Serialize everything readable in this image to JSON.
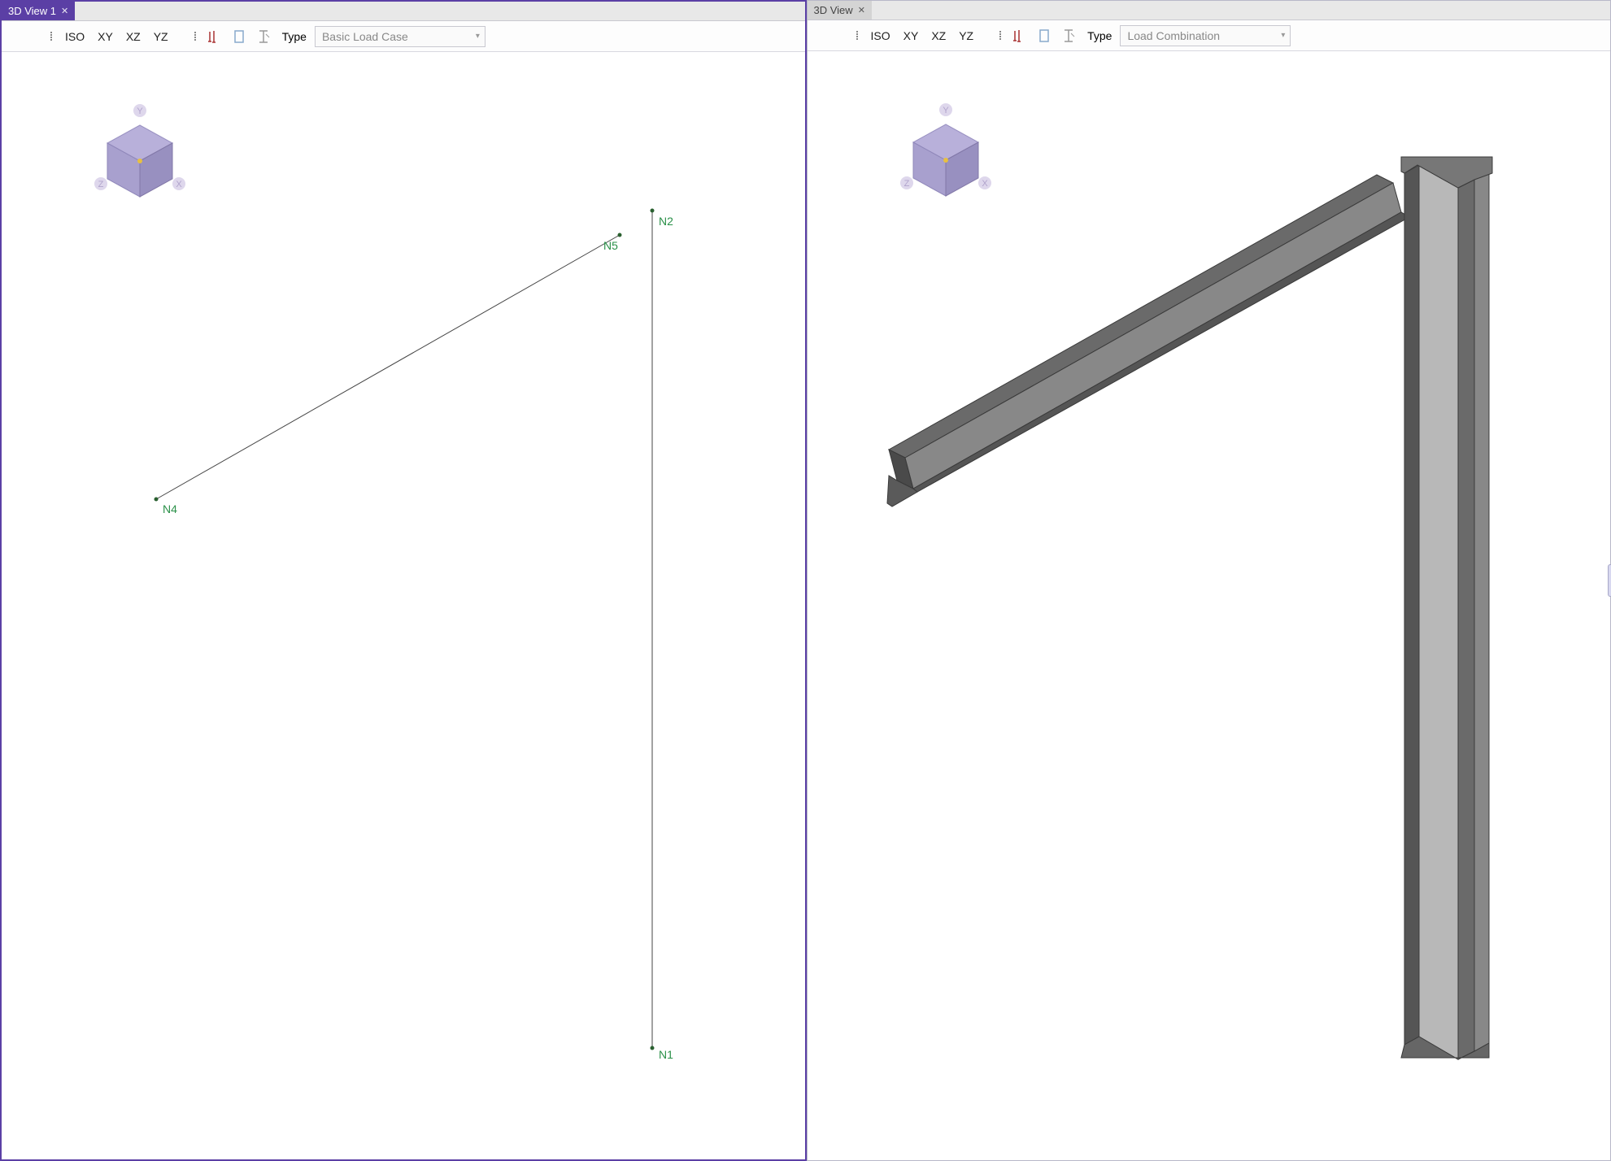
{
  "panels": {
    "left": {
      "tab_label": "3D View 1",
      "active": true,
      "type_label": "Type",
      "type_value": "Basic Load Case",
      "nodes": {
        "n4": "N4",
        "n5": "N5",
        "n2": "N2",
        "n1": "N1"
      },
      "axes": {
        "x": "X",
        "y": "Y",
        "z": "Z"
      }
    },
    "right": {
      "tab_label": "3D View",
      "active": false,
      "type_label": "Type",
      "type_value": "Load Combination",
      "axes": {
        "x": "X",
        "y": "Y",
        "z": "Z"
      }
    }
  },
  "view_buttons": [
    "ISO",
    "XY",
    "XZ",
    "YZ"
  ]
}
